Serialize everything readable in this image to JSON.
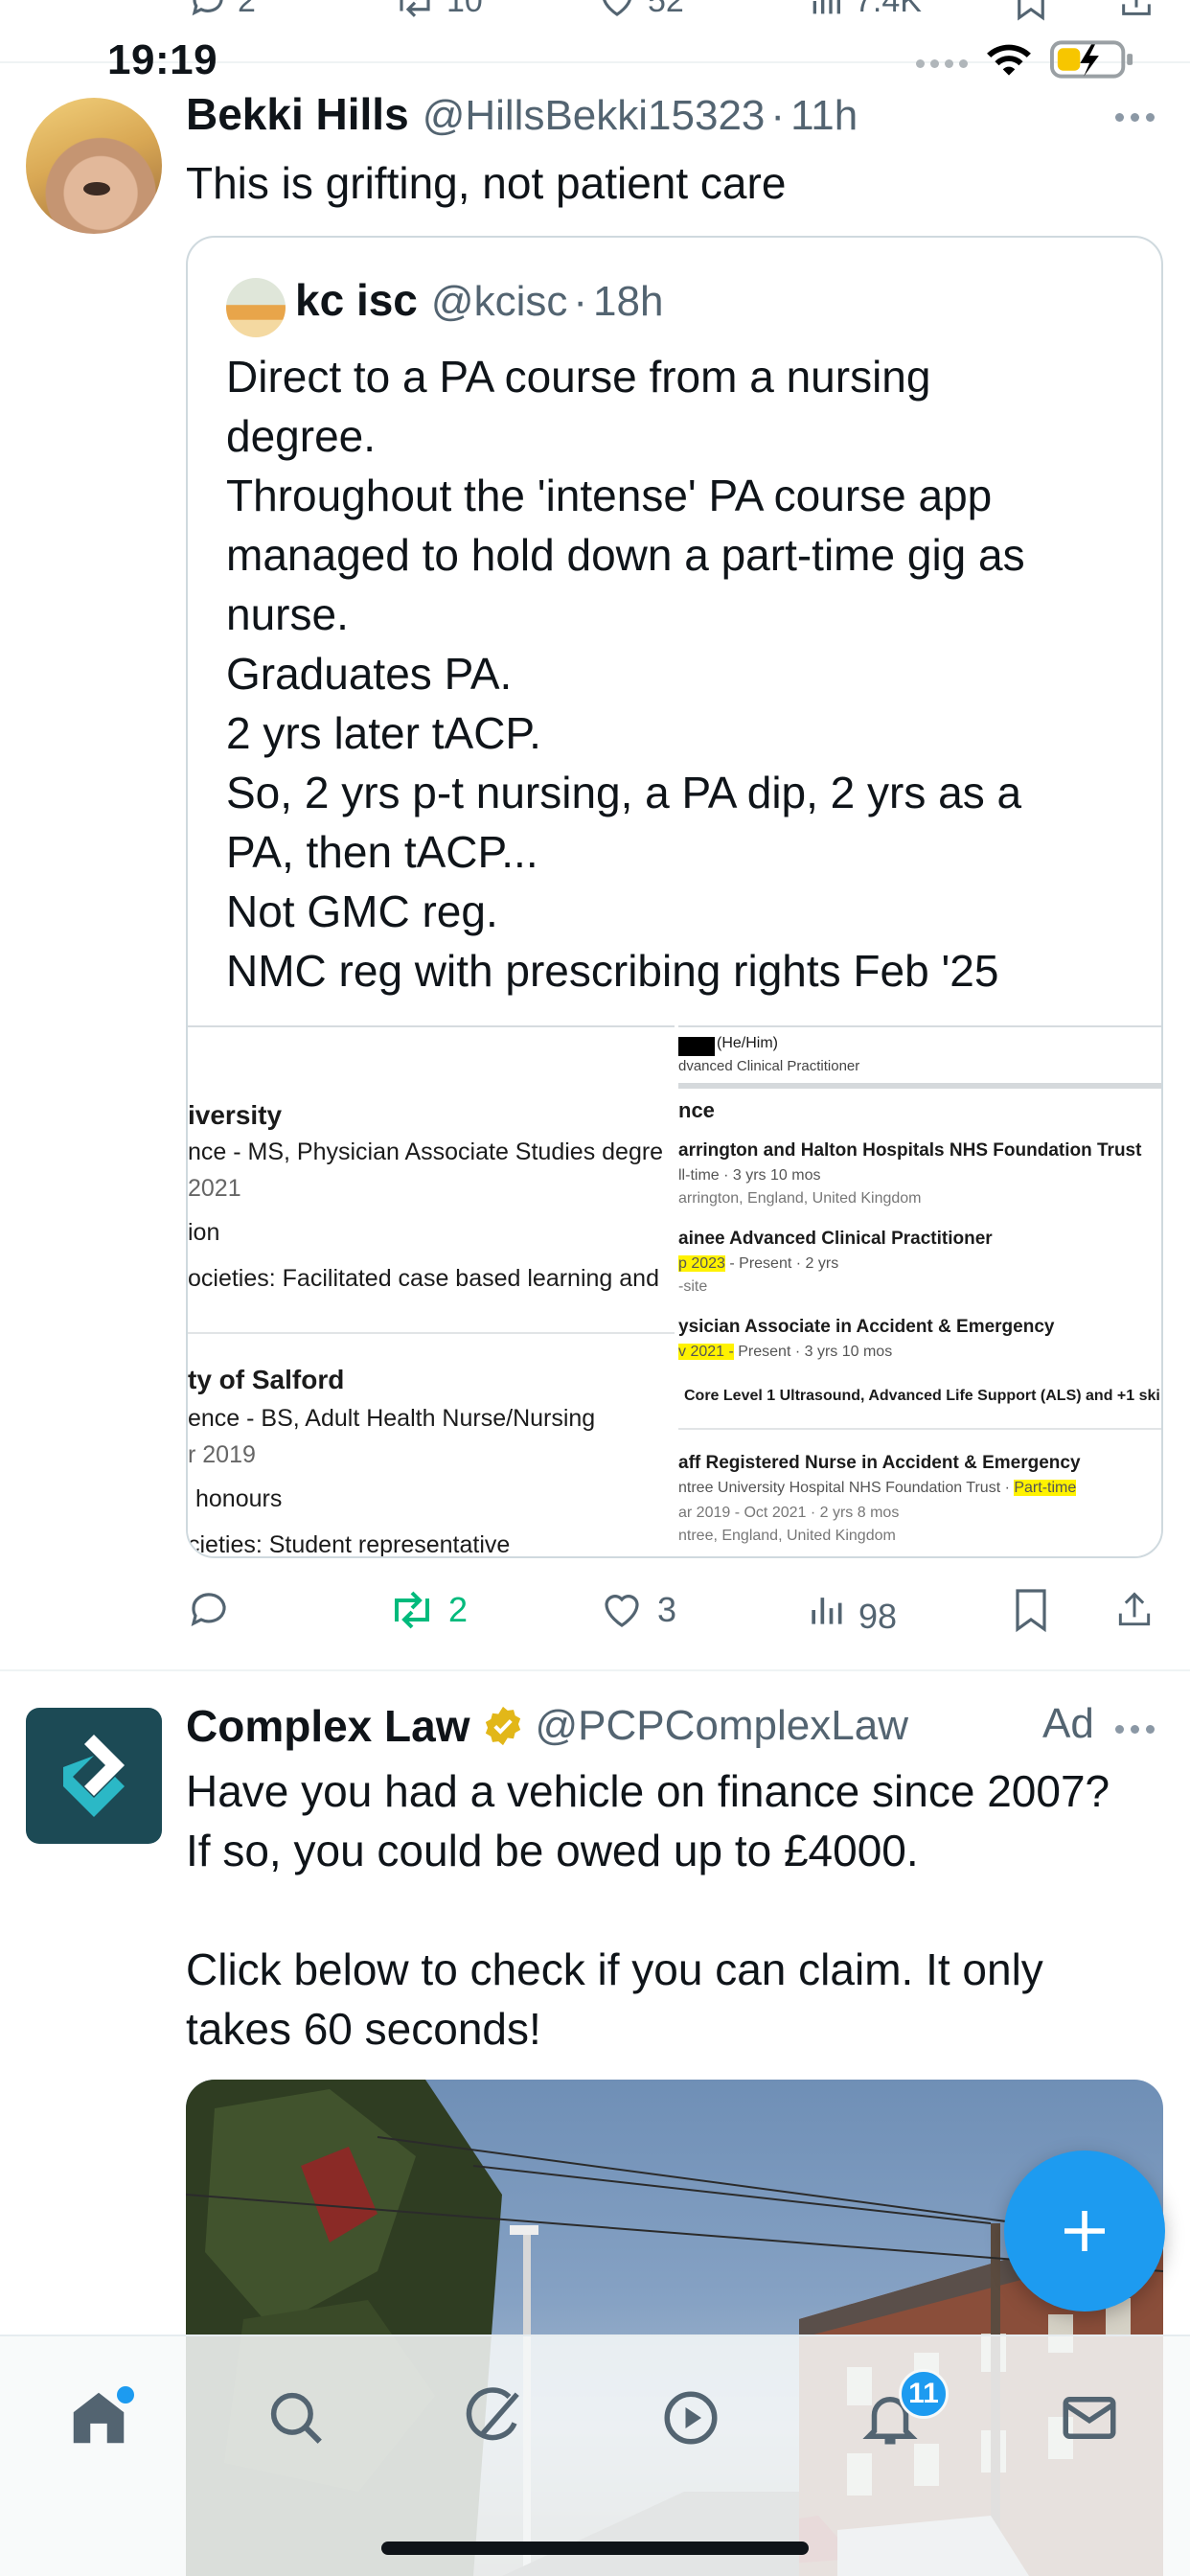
{
  "status_bar": {
    "time": "19:19"
  },
  "prev_post_actions": {
    "replies": "2",
    "reposts": "10",
    "likes": "52",
    "views": "7.4K"
  },
  "post": {
    "author_name": "Bekki Hills",
    "author_handle": "@HillsBekki15323",
    "dot": "·",
    "time": "11h",
    "text": "This is grifting, not patient care",
    "quote": {
      "author_name": "kc isc",
      "author_handle": "@kcisc",
      "dot": "·",
      "time": "18h",
      "lines": [
        "Direct to a PA course from a nursing",
        "degree.",
        "Throughout the 'intense'  PA course app",
        "managed to hold down a part-time gig as",
        "nurse.",
        "Graduates PA.",
        "2 yrs later tACP.",
        "So, 2 yrs p-t nursing, a PA dip, 2 yrs as a",
        "PA, then tACP...",
        "Not GMC reg.",
        "NMC reg with prescribing rights Feb '25"
      ],
      "image_left": {
        "school1": "iversity",
        "degree1": "nce - MS, Physician Associate Studies degre",
        "year1": "2021",
        "note1": "ion",
        "act1": "ocieties: Facilitated case based learning and",
        "school2": "ty of Salford",
        "degree2": "ence - BS, Adult Health Nurse/Nursing",
        "year2": "r 2019",
        "note2": "honours",
        "act2": "cieties: Student representative"
      },
      "image_right": {
        "pronouns": "(He/Him)",
        "headline": "dvanced Clinical Practitioner",
        "section": "nce",
        "org": "arrington and Halton Hospitals NHS Foundation Trust",
        "org_meta": "ll-time · 3 yrs 10 mos",
        "org_loc": "arrington, England, United Kingdom",
        "role1": "ainee Advanced Clinical Practitioner",
        "role1_date_hl": "p 2023",
        "role1_date": " - Present · 2 yrs",
        "role1_site": "-site",
        "role2": "ysician Associate in Accident & Emergency",
        "role2_date_hl": "v 2021 -",
        "role2_date": " Present · 3 yrs 10 mos",
        "role2_skills": "Core Level 1 Ultrasound, Advanced Life Support (ALS) and +1 skil",
        "role3": "aff Registered Nurse in Accident & Emergency",
        "role3_org": "ntree University Hospital NHS Foundation Trust · ",
        "role3_org_hl": "Part-time",
        "role3_date": "ar 2019 - Oct 2021 · 2 yrs 8 mos",
        "role3_loc": "ntree, England, United Kingdom"
      }
    },
    "actions": {
      "replies": "",
      "reposts": "2",
      "likes": "3",
      "views": "98"
    }
  },
  "ad": {
    "author_name": "Complex Law",
    "author_handle": "@PCPComplexLaw",
    "ad_label": "Ad",
    "text_lines": [
      "Have you had a vehicle on finance since 2007?",
      "If so, you could be owed up to £4000.",
      "",
      "Click below to check if you can claim. It only",
      "takes 60 seconds!"
    ]
  },
  "tab_bar": {
    "notifications_badge": "11",
    "tabs": [
      "home-icon",
      "search-icon",
      "grok-icon",
      "video-icon",
      "bell-icon",
      "mail-icon"
    ]
  },
  "colors": {
    "accent": "#1d9bf0",
    "repost_green": "#00ba7c",
    "muted": "#536471",
    "highlight": "#fff200"
  }
}
